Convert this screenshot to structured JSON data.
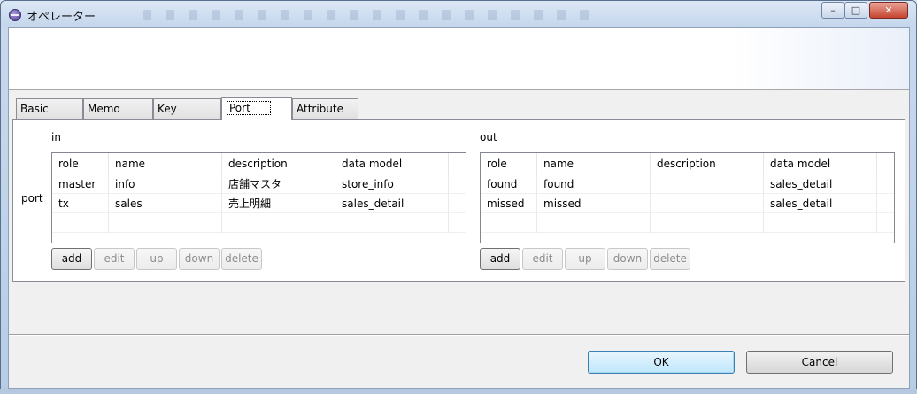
{
  "window": {
    "title": "オペレーター"
  },
  "window_controls": {
    "minimize": "–",
    "maximize": "□",
    "close": "✕"
  },
  "tabs": [
    {
      "label": "Basic"
    },
    {
      "label": "Memo"
    },
    {
      "label": "Key"
    },
    {
      "label": "Port"
    },
    {
      "label": "Attribute"
    }
  ],
  "active_tab": "Port",
  "port_panel": {
    "port_label": "port",
    "in": {
      "label": "in",
      "columns": [
        "role",
        "name",
        "description",
        "data model"
      ],
      "rows": [
        {
          "role": "master",
          "name": "info",
          "description": "店舗マスタ",
          "data_model": "store_info"
        },
        {
          "role": "tx",
          "name": "sales",
          "description": "売上明細",
          "data_model": "sales_detail"
        }
      ],
      "buttons": {
        "add": "add",
        "edit": "edit",
        "up": "up",
        "down": "down",
        "delete": "delete"
      }
    },
    "out": {
      "label": "out",
      "columns": [
        "role",
        "name",
        "description",
        "data model"
      ],
      "rows": [
        {
          "role": "found",
          "name": "found",
          "description": "",
          "data_model": "sales_detail"
        },
        {
          "role": "missed",
          "name": "missed",
          "description": "",
          "data_model": "sales_detail"
        }
      ],
      "buttons": {
        "add": "add",
        "edit": "edit",
        "up": "up",
        "down": "down",
        "delete": "delete"
      }
    }
  },
  "dialog_buttons": {
    "ok": "OK",
    "cancel": "Cancel"
  }
}
